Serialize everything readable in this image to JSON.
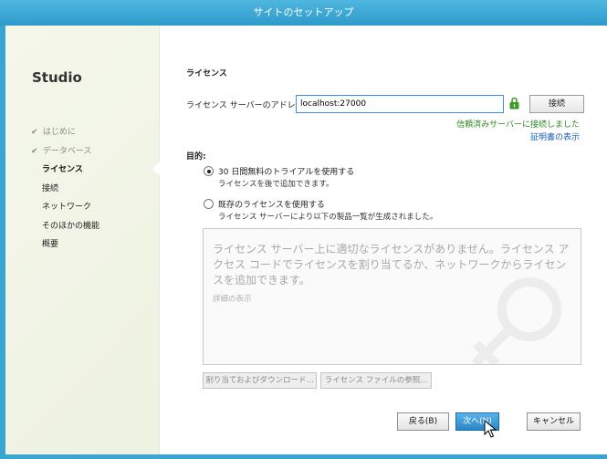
{
  "window": {
    "title": "サイトのセットアップ"
  },
  "sidebar": {
    "product": "Studio",
    "steps": [
      {
        "label": "はじめに",
        "state": "done"
      },
      {
        "label": "データベース",
        "state": "done"
      },
      {
        "label": "ライセンス",
        "state": "active"
      },
      {
        "label": "接続",
        "state": "pending"
      },
      {
        "label": "ネットワーク",
        "state": "pending"
      },
      {
        "label": "そのほかの機能",
        "state": "pending"
      },
      {
        "label": "概要",
        "state": "pending"
      }
    ]
  },
  "main": {
    "heading": "ライセンス",
    "server_label": "ライセンス サーバーのアドレス:",
    "server_value": "localhost:27000",
    "connect_label": "接続",
    "connected_message": "信頼済みサーバーに接続しました",
    "cert_link": "証明書の表示",
    "purpose_label": "目的:",
    "options": [
      {
        "title": "30 日間無料のトライアルを使用する",
        "subtitle": "ライセンスを後で追加できます。",
        "selected": true
      },
      {
        "title": "既存のライセンスを使用する",
        "subtitle": "ライセンス サーバーにより以下の製品一覧が生成されました。",
        "selected": false
      }
    ],
    "license_box": {
      "message": "ライセンス サーバー上に適切なライセンスがありません。ライセンス アクセス コードでライセンスを割り当てるか、ネットワークからライセンスを追加できます。",
      "details_link": "詳細の表示"
    },
    "assign_button": "割り当ておよびダウンロード...",
    "browse_button": "ライセンス ファイルの参照..."
  },
  "footer": {
    "back": "戻る(B)",
    "next": "次へ(N)",
    "cancel": "キャンセル"
  },
  "colors": {
    "titlebar": "#3aa6d0",
    "success": "#2b8a1e",
    "link": "#1a5fb4",
    "primary_button": "#2a86c8"
  },
  "icons": [
    "lock-icon",
    "check-icon",
    "cursor-icon"
  ]
}
